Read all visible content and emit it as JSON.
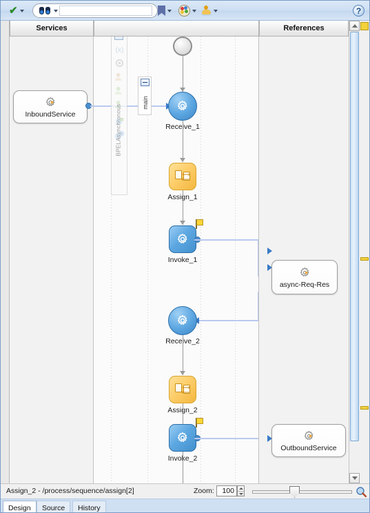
{
  "toolbar": {
    "validate_label": "validate-check",
    "search_placeholder": "",
    "search_value": "",
    "bookmark_label": "bookmark",
    "palette_label": "palette",
    "person_label": "human-task",
    "help_label": "?"
  },
  "panels": {
    "services_header": "Services",
    "canvas_header": "",
    "references_header": "References"
  },
  "palette": {
    "vertical_label": "BPELAsynchronous",
    "main_label": "main"
  },
  "flow": {
    "nodes": [
      {
        "id": "start",
        "label": "",
        "type": "start"
      },
      {
        "id": "receive1",
        "label": "Receive_1",
        "type": "receive"
      },
      {
        "id": "assign1",
        "label": "Assign_1",
        "type": "assign"
      },
      {
        "id": "invoke1",
        "label": "Invoke_1",
        "type": "invoke"
      },
      {
        "id": "receive2",
        "label": "Receive_2",
        "type": "receive"
      },
      {
        "id": "assign2",
        "label": "Assign_2",
        "type": "assign"
      },
      {
        "id": "invoke2",
        "label": "Invoke_2",
        "type": "invoke"
      }
    ]
  },
  "services": [
    {
      "id": "inbound",
      "label": "InboundService"
    }
  ],
  "references": [
    {
      "id": "asyncreqres",
      "label": "async-Req-Res"
    },
    {
      "id": "outbound",
      "label": "OutboundService"
    }
  ],
  "status": {
    "selection": "Assign_2 - /process/sequence/assign[2]",
    "zoom_label": "Zoom:",
    "zoom_value": "100"
  },
  "tabs": [
    {
      "id": "design",
      "label": "Design",
      "active": true
    },
    {
      "id": "source",
      "label": "Source",
      "active": false
    },
    {
      "id": "history",
      "label": "History",
      "active": false
    }
  ],
  "colors": {
    "accent_blue": "#3d86c6",
    "assign_orange": "#f3b73f",
    "marker_yellow": "#f2d13b",
    "toolbar_blue": "#cfe0f3"
  }
}
